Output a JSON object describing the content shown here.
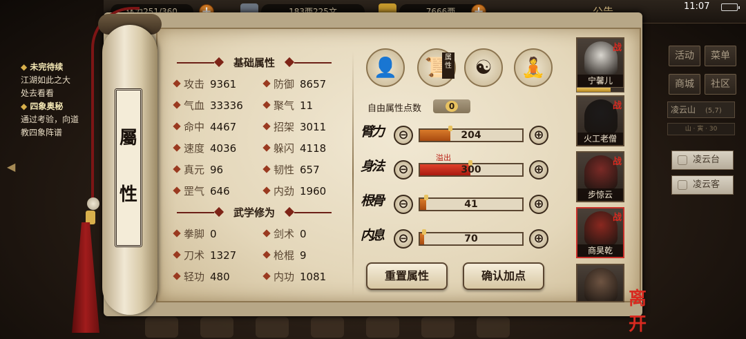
{
  "topbar": {
    "stamina": "体力251/360",
    "silver": "183两225文",
    "gold": "7666两",
    "notice": "公告",
    "clock": "11:07"
  },
  "quest": {
    "heading1": "未完待续",
    "text1a": "江湖如此之大",
    "text1b": "处去看看",
    "heading2": "四象奥秘",
    "text2a": "通过考验，向道",
    "text2b": "教四象阵谱"
  },
  "side_menu": {
    "activity": "活动",
    "menu": "菜单",
    "shop": "商城",
    "community": "社区",
    "location": "凌云山",
    "coords": "(5,7)",
    "map_strip": "山 · 寅 · 30",
    "poi1": "凌云台",
    "poi2": "凌云客"
  },
  "panel": {
    "title_top": "屬",
    "title_bottom": "性"
  },
  "basic": {
    "heading": "基础属性",
    "stats": [
      {
        "label": "攻击",
        "value": "9361"
      },
      {
        "label": "防御",
        "value": "8657"
      },
      {
        "label": "气血",
        "value": "33336"
      },
      {
        "label": "聚气",
        "value": "11"
      },
      {
        "label": "命中",
        "value": "4467"
      },
      {
        "label": "招架",
        "value": "3011"
      },
      {
        "label": "速度",
        "value": "4036"
      },
      {
        "label": "躲闪",
        "value": "4118"
      },
      {
        "label": "真元",
        "value": "96"
      },
      {
        "label": "韧性",
        "value": "657"
      },
      {
        "label": "罡气",
        "value": "646"
      },
      {
        "label": "内劲",
        "value": "1960"
      }
    ]
  },
  "martial": {
    "heading": "武学修为",
    "stats": [
      {
        "label": "拳脚",
        "value": "0"
      },
      {
        "label": "剑术",
        "value": "0"
      },
      {
        "label": "刀术",
        "value": "1327"
      },
      {
        "label": "枪棍",
        "value": "9"
      },
      {
        "label": "轻功",
        "value": "480"
      },
      {
        "label": "内功",
        "value": "1081"
      }
    ]
  },
  "category_tag": "属性",
  "free_points": {
    "label": "自由属性点数",
    "value": "0"
  },
  "attributes": [
    {
      "name": "臂力",
      "value": "204",
      "fill": 0.3
    },
    {
      "name": "身法",
      "value": "300",
      "fill": 0.49,
      "over": true
    },
    {
      "name": "根骨",
      "value": "41",
      "fill": 0.06
    },
    {
      "name": "内息",
      "value": "70",
      "fill": 0.04
    }
  ],
  "overflow_label": "溢出",
  "minus_symbol": "⊖",
  "plus_symbol": "⊕",
  "buttons": {
    "reset": "重置属性",
    "confirm": "确认加点"
  },
  "characters": [
    {
      "name": "宁馨儿",
      "battle": "战",
      "face_color": "#d9d6cf"
    },
    {
      "name": "火工老僧",
      "battle": "战",
      "face_color": "#1c1a1a"
    },
    {
      "name": "步惊云",
      "battle": "战",
      "face_color": "#7a2a26"
    },
    {
      "name": "商昊乾",
      "battle": "战",
      "face_color": "#8a2820"
    },
    {
      "name": "",
      "battle": "",
      "face_color": "#6e5442"
    }
  ],
  "leave": "离开"
}
